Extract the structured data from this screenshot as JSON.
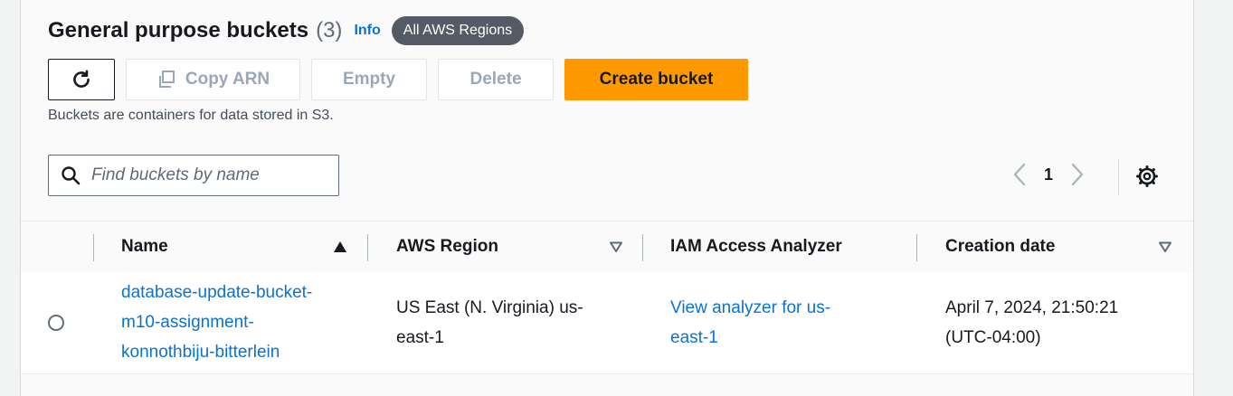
{
  "header": {
    "title": "General purpose buckets",
    "count": "(3)",
    "info_label": "Info",
    "region_filter": "All AWS Regions"
  },
  "toolbar": {
    "refresh_icon": "refresh-icon",
    "copy_arn_label": "Copy ARN",
    "copy_icon": "copy-icon",
    "empty_label": "Empty",
    "delete_label": "Delete",
    "create_label": "Create bucket"
  },
  "description": "Buckets are containers for data stored in S3.",
  "search": {
    "placeholder": "Find buckets by name",
    "value": ""
  },
  "pagination": {
    "current_page": "1",
    "prev_icon": "chevron-left-icon",
    "next_icon": "chevron-right-icon",
    "settings_icon": "gear-icon"
  },
  "table": {
    "columns": [
      {
        "label": "Name",
        "sort": "ascending"
      },
      {
        "label": "AWS Region",
        "sort": "none"
      },
      {
        "label": "IAM Access Analyzer",
        "sort": "none"
      },
      {
        "label": "Creation date",
        "sort": "none"
      }
    ],
    "rows": [
      {
        "name_lines": [
          "database-update-bucket-",
          "m10-assignment-",
          "konnothbiju-bitterlein"
        ],
        "region_lines": [
          "US East (N. Virginia) us-",
          "east-1"
        ],
        "analyzer_lines": [
          "View analyzer for us-",
          "east-1"
        ],
        "date_lines": [
          "April 7, 2024, 21:50:21",
          "(UTC-04:00)"
        ]
      }
    ]
  },
  "colors": {
    "accent_orange": "#ff9900",
    "link_blue": "#0972d3",
    "badge_gray": "#545b64",
    "text_dark": "#16191f",
    "disabled_text": "#9ba7b6"
  }
}
